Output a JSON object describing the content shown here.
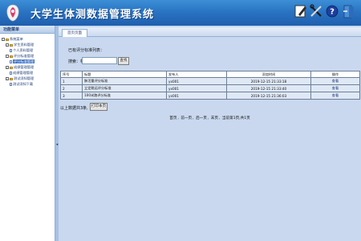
{
  "header": {
    "title": "大学生体测数据管理系统",
    "tools": [
      "edit-icon",
      "tools-icon",
      "help-icon",
      "exit-icon"
    ]
  },
  "sidebar": {
    "title": "功能菜单",
    "items": [
      {
        "label": "系统菜单",
        "level": 0,
        "type": "folder"
      },
      {
        "label": "学生资料管理",
        "level": 1,
        "type": "folder"
      },
      {
        "label": "个人资料管理",
        "level": 2,
        "type": "doc"
      },
      {
        "label": "评分标准管理",
        "level": 1,
        "type": "folder"
      },
      {
        "label": "评分标准管理",
        "level": 2,
        "type": "doc",
        "selected": true
      },
      {
        "label": "成绩管理管理",
        "level": 1,
        "type": "folder"
      },
      {
        "label": "成绩管理管理",
        "level": 2,
        "type": "doc"
      },
      {
        "label": "测试须知管理",
        "level": 1,
        "type": "folder"
      },
      {
        "label": "测试须知下载",
        "level": 2,
        "type": "doc"
      }
    ]
  },
  "tabs": [
    {
      "label": "首页页面"
    }
  ],
  "content": {
    "list_caption": "已有评分标准列表：",
    "search_label": "搜索：标题：",
    "search_value": "",
    "search_button": "查找",
    "table": {
      "headers": [
        "序号",
        "标题",
        "发布人",
        "添加时间",
        "操作"
      ],
      "rows": [
        {
          "no": "1",
          "title": "肺活量评分标准",
          "author": "yx001",
          "time": "2019-12-15 21:33:18",
          "action": "查看"
        },
        {
          "no": "2",
          "title": "立定跳远评分标准",
          "author": "yx001",
          "time": "2019-12-15 21:33:40",
          "action": "查看"
        },
        {
          "no": "3",
          "title": "100米跑评分标准",
          "author": "yx001",
          "time": "2019-12-15 21:36:03",
          "action": "查看"
        }
      ]
    },
    "print_caption": "以上数据共3条,",
    "print_button": "打印本页",
    "pager": {
      "first": "首页",
      "prev": "前一页",
      "next": "后一页",
      "last": "末页",
      "current": "当前第1页,共1页"
    }
  },
  "colors": {
    "header": "#2a74c3",
    "panel_bg": "#c9d8ee",
    "row_bg": "#dfe8f5"
  }
}
